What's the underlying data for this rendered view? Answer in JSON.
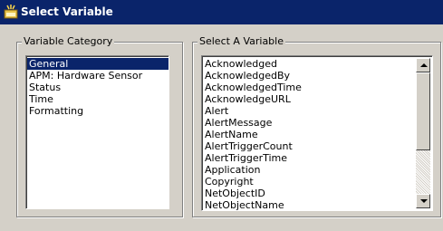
{
  "window": {
    "title": "Select Variable",
    "icon": "select-variable-icon"
  },
  "category_group": {
    "label": "Variable Category",
    "items": [
      "General",
      "APM: Hardware Sensor",
      "Status",
      "Time",
      "Formatting"
    ],
    "selected": "General"
  },
  "variable_group": {
    "label": "Select A Variable",
    "items": [
      "Acknowledged",
      "AcknowledgedBy",
      "AcknowledgedTime",
      "AcknowledgeURL",
      "Alert",
      "AlertMessage",
      "AlertName",
      "AlertTriggerCount",
      "AlertTriggerTime",
      "Application",
      "Copyright",
      "NetObjectID",
      "NetObjectName"
    ]
  },
  "colors": {
    "titlebar": "#0a246a",
    "selection": "#0a246a",
    "face": "#d4d0c8"
  }
}
